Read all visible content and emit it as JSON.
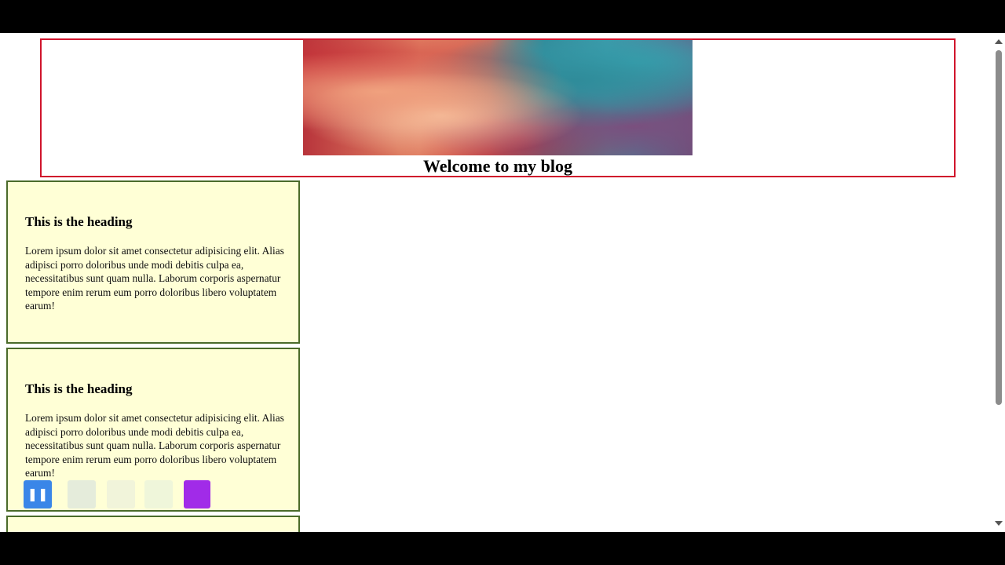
{
  "header": {
    "title": "Welcome to my blog",
    "border_color": "#d0142c",
    "banner_icon": "abstract-paint-banner-image"
  },
  "cards": [
    {
      "heading": "This is the heading",
      "body": "Lorem ipsum dolor sit amet consectetur adipisicing elit. Alias adipisci porro doloribus unde modi debitis culpa ea, necessitatibus sunt quam nulla. Laborum corporis aspernatur tempore enim rerum eum porro doloribus libero voluptatem earum!"
    },
    {
      "heading": "This is the heading",
      "body": "Lorem ipsum dolor sit amet consectetur adipisicing elit. Alias adipisci porro doloribus unde modi debitis culpa ea, necessitatibus sunt quam nulla. Laborum corporis aspernatur tempore enim rerum eum porro doloribus libero voluptatem earum!"
    }
  ],
  "card_style": {
    "background": "#ffffd6",
    "border_color": "#4b6b2a"
  },
  "recorder_toolbar": {
    "pause_icon": "pause-icon",
    "pause_color": "#3a86e8",
    "stop_icon": "stop-icon",
    "stop_color": "#a12be8"
  }
}
